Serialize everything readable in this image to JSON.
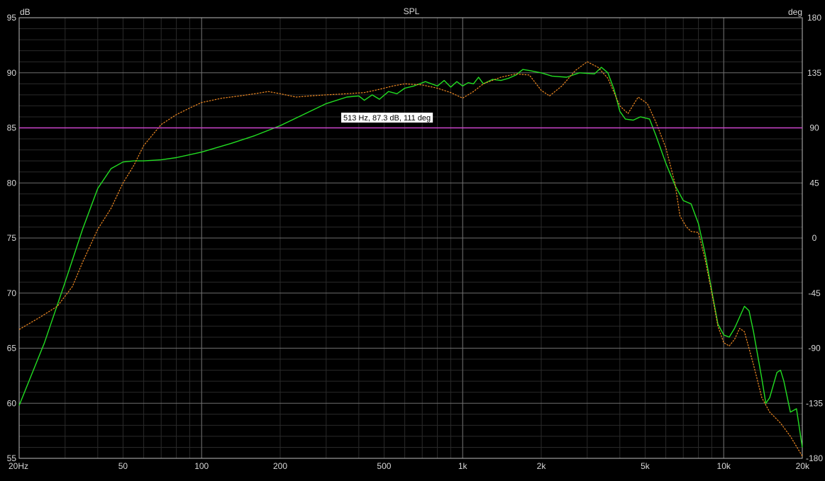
{
  "chart_data": {
    "type": "line",
    "title": "SPL",
    "y_unit_left": "dB",
    "y_unit_right": "deg",
    "x_scale": "log",
    "xlim": [
      20,
      20000
    ],
    "ylim": [
      55,
      95
    ],
    "y2lim": [
      -180,
      180
    ],
    "grid": true,
    "x_ticks": [
      {
        "v": 20,
        "label": "20Hz"
      },
      {
        "v": 50,
        "label": "50"
      },
      {
        "v": 100,
        "label": "100"
      },
      {
        "v": 200,
        "label": "200"
      },
      {
        "v": 500,
        "label": "500"
      },
      {
        "v": 1000,
        "label": "1k"
      },
      {
        "v": 2000,
        "label": "2k"
      },
      {
        "v": 5000,
        "label": "5k"
      },
      {
        "v": 10000,
        "label": "10k"
      },
      {
        "v": 20000,
        "label": "20k"
      }
    ],
    "y_ticks": [
      55,
      60,
      65,
      70,
      75,
      80,
      85,
      90,
      95
    ],
    "y2_ticks": [
      -180,
      -135,
      -90,
      -45,
      0,
      45,
      90,
      135,
      180
    ],
    "marker": {
      "y": 85,
      "color": "#cc44cc",
      "label": "513 Hz, 87.3 dB, 111 deg"
    },
    "series": [
      {
        "color": "#22dd22",
        "style": "solid",
        "points": [
          [
            20,
            59.8
          ],
          [
            25,
            65.5
          ],
          [
            30,
            71
          ],
          [
            35,
            75.8
          ],
          [
            40,
            79.5
          ],
          [
            45,
            81.3
          ],
          [
            50,
            81.9
          ],
          [
            55,
            82
          ],
          [
            60,
            82
          ],
          [
            70,
            82.1
          ],
          [
            80,
            82.3
          ],
          [
            100,
            82.8
          ],
          [
            130,
            83.6
          ],
          [
            160,
            84.3
          ],
          [
            200,
            85.2
          ],
          [
            250,
            86.3
          ],
          [
            300,
            87.2
          ],
          [
            360,
            87.8
          ],
          [
            400,
            87.9
          ],
          [
            420,
            87.5
          ],
          [
            450,
            88
          ],
          [
            480,
            87.6
          ],
          [
            520,
            88.3
          ],
          [
            560,
            88.1
          ],
          [
            600,
            88.6
          ],
          [
            650,
            88.8
          ],
          [
            720,
            89.2
          ],
          [
            800,
            88.8
          ],
          [
            850,
            89.3
          ],
          [
            900,
            88.7
          ],
          [
            950,
            89.2
          ],
          [
            1000,
            88.8
          ],
          [
            1050,
            89.1
          ],
          [
            1100,
            89
          ],
          [
            1150,
            89.6
          ],
          [
            1200,
            89
          ],
          [
            1300,
            89.4
          ],
          [
            1400,
            89.3
          ],
          [
            1500,
            89.5
          ],
          [
            1600,
            89.8
          ],
          [
            1700,
            90.3
          ],
          [
            1800,
            90.2
          ],
          [
            2000,
            90
          ],
          [
            2200,
            89.7
          ],
          [
            2500,
            89.6
          ],
          [
            2800,
            90
          ],
          [
            3200,
            89.9
          ],
          [
            3400,
            90.5
          ],
          [
            3600,
            90
          ],
          [
            3800,
            88.5
          ],
          [
            4000,
            86.5
          ],
          [
            4200,
            85.8
          ],
          [
            4500,
            85.7
          ],
          [
            4800,
            86
          ],
          [
            5200,
            85.8
          ],
          [
            5500,
            84.3
          ],
          [
            6000,
            81.8
          ],
          [
            6500,
            79.8
          ],
          [
            7000,
            78.4
          ],
          [
            7500,
            78.1
          ],
          [
            8000,
            76.3
          ],
          [
            8500,
            73.5
          ],
          [
            9000,
            70.2
          ],
          [
            9500,
            67.2
          ],
          [
            10000,
            66.2
          ],
          [
            10500,
            66
          ],
          [
            11000,
            66.8
          ],
          [
            12000,
            68.8
          ],
          [
            12500,
            68.4
          ],
          [
            13000,
            66.5
          ],
          [
            14000,
            62.2
          ],
          [
            14500,
            60
          ],
          [
            15000,
            60.5
          ],
          [
            16000,
            62.8
          ],
          [
            16500,
            63
          ],
          [
            17000,
            62
          ],
          [
            18000,
            59.2
          ],
          [
            19000,
            59.5
          ],
          [
            20000,
            56
          ]
        ]
      },
      {
        "color": "#ee8822",
        "style": "dashed",
        "points": [
          [
            20,
            66.7
          ],
          [
            24,
            67.8
          ],
          [
            28,
            68.8
          ],
          [
            32,
            70.6
          ],
          [
            35,
            72.8
          ],
          [
            40,
            75.8
          ],
          [
            45,
            77.7
          ],
          [
            50,
            80
          ],
          [
            55,
            81.6
          ],
          [
            60,
            83.4
          ],
          [
            70,
            85.3
          ],
          [
            80,
            86.2
          ],
          [
            90,
            86.8
          ],
          [
            100,
            87.3
          ],
          [
            120,
            87.7
          ],
          [
            140,
            87.9
          ],
          [
            160,
            88.1
          ],
          [
            180,
            88.3
          ],
          [
            200,
            88.1
          ],
          [
            230,
            87.8
          ],
          [
            260,
            87.9
          ],
          [
            300,
            88
          ],
          [
            360,
            88.1
          ],
          [
            420,
            88.2
          ],
          [
            480,
            88.5
          ],
          [
            540,
            88.8
          ],
          [
            600,
            89
          ],
          [
            700,
            88.9
          ],
          [
            800,
            88.6
          ],
          [
            900,
            88.2
          ],
          [
            1000,
            87.7
          ],
          [
            1100,
            88.3
          ],
          [
            1200,
            89
          ],
          [
            1400,
            89.6
          ],
          [
            1600,
            89.9
          ],
          [
            1800,
            89.8
          ],
          [
            2000,
            88.4
          ],
          [
            2150,
            87.9
          ],
          [
            2400,
            88.8
          ],
          [
            2700,
            90.2
          ],
          [
            3000,
            91
          ],
          [
            3300,
            90.5
          ],
          [
            3600,
            89.5
          ],
          [
            4000,
            87
          ],
          [
            4300,
            86.3
          ],
          [
            4700,
            87.8
          ],
          [
            5100,
            87.2
          ],
          [
            5500,
            85.5
          ],
          [
            6000,
            83.2
          ],
          [
            6500,
            80
          ],
          [
            6800,
            77
          ],
          [
            7200,
            76
          ],
          [
            7500,
            75.6
          ],
          [
            8000,
            75.5
          ],
          [
            8500,
            73
          ],
          [
            9000,
            70
          ],
          [
            9500,
            67
          ],
          [
            10000,
            65.5
          ],
          [
            10500,
            65.2
          ],
          [
            11000,
            65.8
          ],
          [
            11500,
            66.8
          ],
          [
            12000,
            66.5
          ],
          [
            13000,
            63.5
          ],
          [
            14000,
            60.5
          ],
          [
            15000,
            59.2
          ],
          [
            16500,
            58.2
          ],
          [
            18000,
            57
          ],
          [
            20000,
            55.2
          ]
        ]
      }
    ]
  }
}
